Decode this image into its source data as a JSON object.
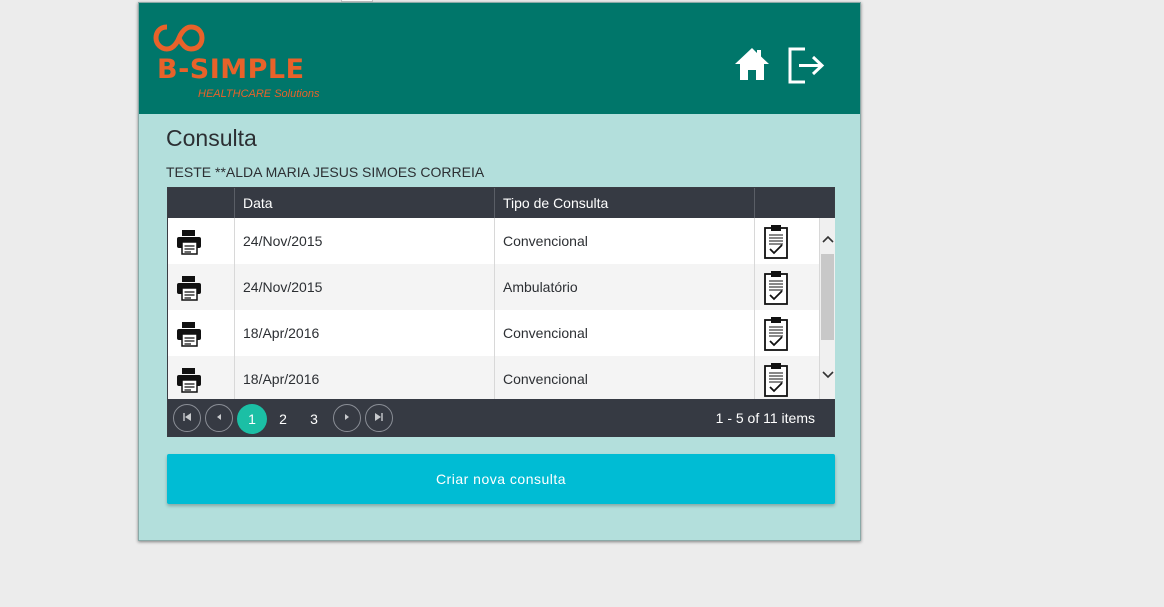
{
  "app": {
    "logo_text": "B-SIMPLE",
    "logo_subtitle": "HEALTHCARE Solutions",
    "brand_color": "#e8622a",
    "header_color": "#00766a"
  },
  "header": {
    "home_icon": "home-icon",
    "logout_icon": "logout-icon"
  },
  "page": {
    "title": "Consulta",
    "patient_name": "TESTE **ALDA MARIA JESUS SIMOES CORREIA"
  },
  "grid": {
    "columns": [
      "",
      "Data",
      "Tipo de Consulta",
      ""
    ],
    "rows": [
      {
        "data": "24/Nov/2015",
        "tipo": "Convencional"
      },
      {
        "data": "24/Nov/2015",
        "tipo": "Ambulatório"
      },
      {
        "data": "18/Apr/2016",
        "tipo": "Convencional"
      },
      {
        "data": "18/Apr/2016",
        "tipo": "Convencional"
      }
    ],
    "row_icon_left": "printer-icon",
    "row_icon_right": "clipboard-check-icon"
  },
  "pager": {
    "first": "first-page-icon",
    "prev": "prev-page-icon",
    "next": "next-page-icon",
    "last": "last-page-icon",
    "pages": [
      "1",
      "2",
      "3"
    ],
    "current_page": "1",
    "info": "1 - 5 of 11 items",
    "active_color": "#1bbfa5"
  },
  "actions": {
    "create_label": "Criar nova consulta",
    "create_color": "#00bcd4"
  }
}
